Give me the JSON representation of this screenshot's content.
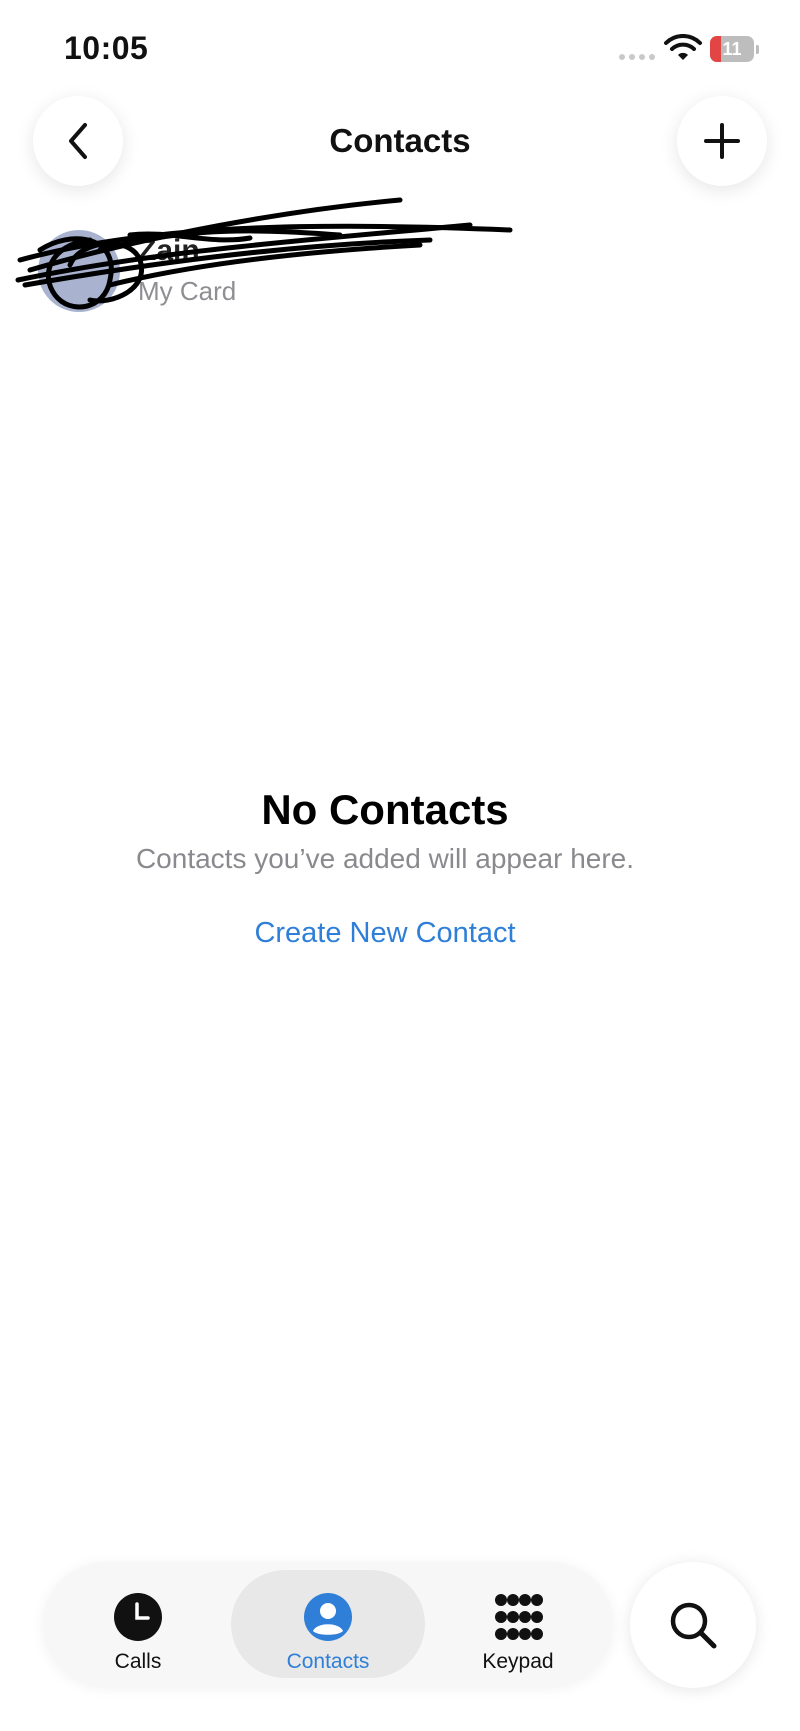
{
  "status_bar": {
    "time": "10:05",
    "battery_level": "11"
  },
  "nav": {
    "title": "Contacts"
  },
  "my_card": {
    "name": "Zain",
    "subtitle": "My Card"
  },
  "empty_state": {
    "title": "No Contacts",
    "message": "Contacts you’ve added will appear here.",
    "action": "Create New Contact"
  },
  "tabs": [
    {
      "label": "Calls",
      "icon": "clock-icon",
      "active": false
    },
    {
      "label": "Contacts",
      "icon": "person-circle-icon",
      "active": true
    },
    {
      "label": "Keypad",
      "icon": "keypad-icon",
      "active": false
    }
  ],
  "colors": {
    "accent": "#2f7fd8",
    "battery_low": "#e34444",
    "avatar": "#a9b3cf",
    "secondary_text": "#8a8a8e"
  }
}
